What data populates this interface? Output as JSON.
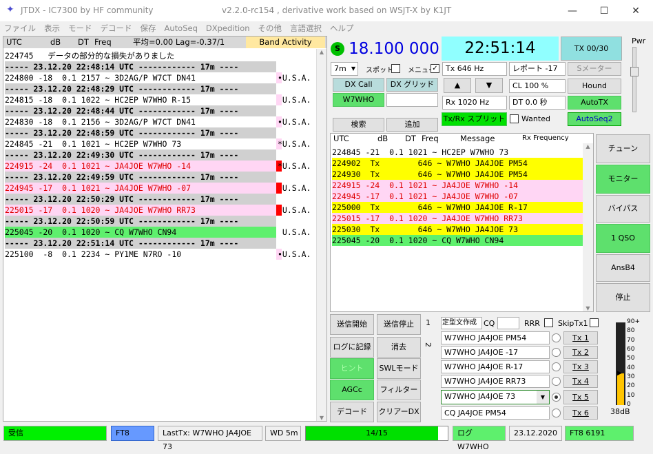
{
  "window": {
    "title": "JTDX - IC7300  by HF community",
    "center": "v2.2.0-rc154 , derivative work based on WSJT-X by K1JT",
    "min": "—",
    "max": "☐",
    "close": "✕"
  },
  "menu": [
    "ファイル",
    "表示",
    "モード",
    "デコード",
    "保存",
    "AutoSeq",
    "DXpedition",
    "その他",
    "言語選択",
    "ヘルプ"
  ],
  "band_header": {
    "utc": "UTC",
    "db": "dB",
    "dt": "DT",
    "freq": "Freq",
    "avg": "平均=0.00 Lag=-0.37/1",
    "band_activity": "Band Activity"
  },
  "band_rows": [
    {
      "text": "224745   データの部分的な損失がありました",
      "kind": "plain",
      "country": ""
    },
    {
      "text": "----- 23.12.20 22:48:14 UTC ------------ 17m ----",
      "kind": "sep",
      "country": ""
    },
    {
      "text": "224800 -18  0.1 2157 ~ 3D2AG/P W7CT DN41",
      "kind": "plain",
      "country": "•U.S.A.",
      "mark": "pink"
    },
    {
      "text": "----- 23.12.20 22:48:29 UTC ------------ 17m ----",
      "kind": "sep",
      "country": ""
    },
    {
      "text": "224815 -18  0.1 1022 ~ HC2EP W7WHO R-15",
      "kind": "plain",
      "country": " U.S.A.",
      "mark": "pink"
    },
    {
      "text": "----- 23.12.20 22:48:44 UTC ------------ 17m ----",
      "kind": "sep",
      "country": ""
    },
    {
      "text": "224830 -18  0.1 2156 ~ 3D2AG/P W7CT DN41",
      "kind": "plain",
      "country": "•U.S.A.",
      "mark": "pink"
    },
    {
      "text": "----- 23.12.20 22:48:59 UTC ------------ 17m ----",
      "kind": "sep",
      "country": ""
    },
    {
      "text": "224845 -21  0.1 1021 ~ HC2EP W7WHO 73",
      "kind": "plain",
      "country": "*U.S.A.",
      "mark": "pink"
    },
    {
      "text": "----- 23.12.20 22:49:30 UTC ------------ 17m ----",
      "kind": "sep",
      "country": ""
    },
    {
      "text": "224915 -24  0.1 1021 ~ JA4JOE W7WHO -14",
      "kind": "red",
      "country": "*U.S.A.",
      "mark": "red"
    },
    {
      "text": "----- 23.12.20 22:49:59 UTC ------------ 17m ----",
      "kind": "sep",
      "country": ""
    },
    {
      "text": "224945 -17  0.1 1021 ~ JA4JOE W7WHO -07",
      "kind": "red",
      "country": " U.S.A.",
      "mark": "red"
    },
    {
      "text": "----- 23.12.20 22:50:29 UTC ------------ 17m ----",
      "kind": "sep",
      "country": ""
    },
    {
      "text": "225015 -17  0.1 1020 ~ JA4JOE W7WHO RR73",
      "kind": "red",
      "country": " U.S.A.",
      "mark": "red"
    },
    {
      "text": "----- 23.12.20 22:50:59 UTC ------------ 17m ----",
      "kind": "sep",
      "country": ""
    },
    {
      "text": "225045 -20  0.1 1020 ~ CQ W7WHO CN94",
      "kind": "green",
      "country": " U.S.A.",
      "mark": "none"
    },
    {
      "text": "----- 23.12.20 22:51:14 UTC ------------ 17m ----",
      "kind": "sep",
      "country": ""
    },
    {
      "text": "225100  -8  0.1 2234 ~ PY1ME N7RO -10",
      "kind": "plain",
      "country": "•U.S.A.",
      "mark": "pink"
    }
  ],
  "top": {
    "s_icon": "S",
    "freq": "18.100 000",
    "clock": "22:51:14",
    "tx_btn": "TX 00/30",
    "pwr": "Pwr"
  },
  "controls": {
    "band": "7m",
    "spot": "スポット",
    "memo": "メニュー",
    "tx": "Tx  646  Hz",
    "report": "レポート -17",
    "smeter": "Sメーター",
    "dxcall_label": "DX Call",
    "dxgrid_label": "DX グリッド",
    "dxcall": "W7WHO",
    "dxgrid": "",
    "cl": "CL  100 %",
    "hound": "Hound",
    "rx": "Rx  1020  Hz",
    "dt": "DT 0.0 秒",
    "autotx": "AutoTX",
    "search": "検索",
    "add": "追加",
    "split": "Tx/Rx スプリット",
    "wanted": "Wanted",
    "autoseq": "AutoSeq2",
    "up": "▲",
    "down": "▼"
  },
  "rx_header": {
    "utc": "UTC",
    "db": "dB",
    "dt": "DT",
    "freq": "Freq",
    "msg": "Message",
    "rxfreq": "Rx Frequency"
  },
  "rx_rows": [
    {
      "text": "224845 -21  0.1 1021 ~ HC2EP W7WHO 73",
      "kind": "plain"
    },
    {
      "text": "224902  Tx        646 ~ W7WHO JA4JOE PM54",
      "kind": "yellow"
    },
    {
      "text": "224930  Tx        646 ~ W7WHO JA4JOE PM54",
      "kind": "yellow"
    },
    {
      "text": "224915 -24  0.1 1021 ~ JA4JOE W7WHO -14",
      "kind": "redpink"
    },
    {
      "text": "224945 -17  0.1 1021 ~ JA4JOE W7WHO -07",
      "kind": "redpink"
    },
    {
      "text": "225000  Tx        646 ~ W7WHO JA4JOE R-17",
      "kind": "yellow"
    },
    {
      "text": "225015 -17  0.1 1020 ~ JA4JOE W7WHO RR73",
      "kind": "redpink"
    },
    {
      "text": "225030  Tx        646 ~ W7WHO JA4JOE 73",
      "kind": "yellow"
    },
    {
      "text": "225045 -20  0.1 1020 ~ CQ W7WHO CN94",
      "kind": "green"
    }
  ],
  "right_buttons": [
    "チューン",
    "モニター",
    "バイパス",
    "1 QSO",
    "AnsB4",
    "停止"
  ],
  "left_buttons": [
    [
      "送信開始",
      "送信停止"
    ],
    [
      "ログに記録",
      "消去"
    ],
    [
      "ヒント",
      "SWLモード"
    ],
    [
      "AGCc",
      "フィルター"
    ],
    [
      "デコード",
      "クリアーDX"
    ]
  ],
  "tx_panel": {
    "tab1": "1",
    "tab2": "2",
    "template": "定型文作成",
    "cq": "CQ",
    "rrr": "RRR",
    "skip": "SkipTx1",
    "msgs": [
      "W7WHO JA4JOE PM54",
      "W7WHO JA4JOE -17",
      "W7WHO JA4JOE R-17",
      "W7WHO JA4JOE RR73",
      "W7WHO JA4JOE 73",
      "CQ JA4JOE PM54"
    ],
    "txbtns": [
      "Tx 1",
      "Tx 2",
      "Tx 3",
      "Tx 4",
      "Tx 5",
      "Tx 6"
    ]
  },
  "meter": {
    "labels": [
      "90+",
      "80",
      "70",
      "60",
      "50",
      "40",
      "30",
      "20",
      "10",
      "0"
    ],
    "value": "38dB",
    "level_db": 38
  },
  "status": {
    "rx": "受信",
    "mode": "FT8",
    "lasttx": "LastTx: W7WHO JA4JOE 73",
    "wd": "WD 5m",
    "progress": "14/15",
    "progress_frac": 0.93,
    "log": "ログ W7WHO",
    "date": "23.12.2020",
    "ft8": "FT8  6191"
  }
}
